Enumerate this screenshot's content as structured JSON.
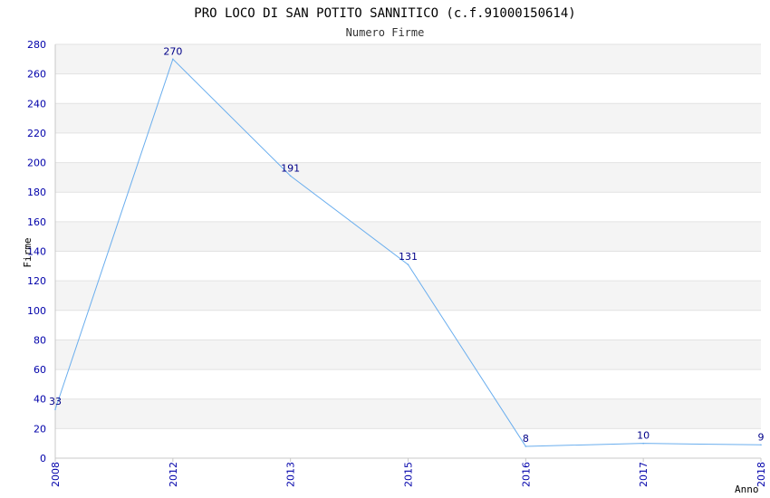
{
  "chart_data": {
    "type": "line",
    "title": "PRO LOCO DI SAN POTITO SANNITICO (c.f.91000150614)",
    "subtitle": "Numero Firme",
    "xlabel": "Anno",
    "ylabel": "Firme",
    "categories": [
      "2008",
      "2012",
      "2013",
      "2015",
      "2016",
      "2017",
      "2018"
    ],
    "series": [
      {
        "values": [
          33,
          270,
          191,
          131,
          8,
          10,
          9
        ]
      }
    ],
    "data_labels": [
      "33",
      "270",
      "191",
      "131",
      "8",
      "10",
      "9"
    ],
    "ylim": [
      0,
      280
    ],
    "yticks": [
      "0",
      "20",
      "40",
      "60",
      "80",
      "100",
      "120",
      "140",
      "160",
      "180",
      "200",
      "220",
      "240",
      "260",
      "280"
    ],
    "grid": true,
    "legend": "none",
    "colors": {
      "line": "#6aaeee",
      "labels": "#000088",
      "ticks": "#0000aa",
      "band": "#f4f4f4",
      "gridline": "#e2e2e2",
      "axis": "#c8c8c8",
      "title": "#000000"
    }
  }
}
